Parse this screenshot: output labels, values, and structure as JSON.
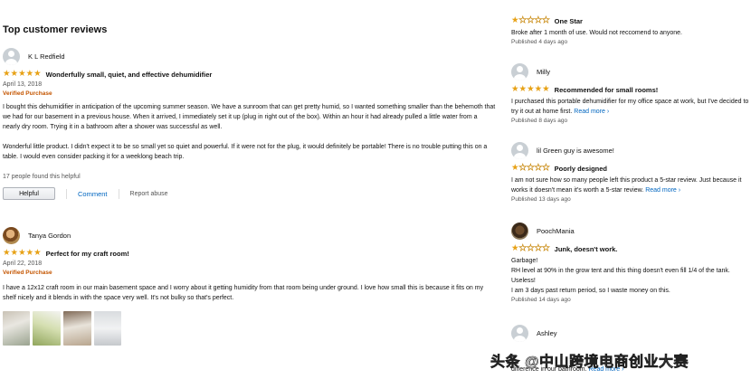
{
  "section_title": "Top customer reviews",
  "reviews": [
    {
      "name": "K L Redfield",
      "rating": 5,
      "title": "Wonderfully small, quiet, and effective dehumidifier",
      "date": "April 13, 2018",
      "verified": "Verified Purchase",
      "paragraphs": [
        "I bought this dehumidifier in anticipation of the upcoming summer season. We have a sunroom that can get pretty humid, so I wanted something smaller than the behemoth that we had for our basement in a previous house. When it arrived, I immediately set it up (plug in right out of the box). Within an hour it had already pulled a little water from a nearly dry room. Trying it in a bathroom after a shower was successful as well.",
        "Wonderful little product. I didn't expect it to be so small yet so quiet and powerful. If it were not for the plug, it would definitely be portable! There is no trouble putting this on a table. I would even consider packing it for a weeklong beach trip."
      ],
      "helpful_count": "17 people found this helpful",
      "helpful_button": "Helpful",
      "comment_link": "Comment",
      "abuse_link": "Report abuse"
    },
    {
      "name": "Tanya Gordon",
      "rating": 5,
      "title": "Perfect for my craft room!",
      "date": "April 22, 2018",
      "verified": "Verified Purchase",
      "paragraphs": [
        "I have a 12x12 craft room in our main basement space and I worry about it getting humidity from that room being under ground. I love how small this is because it fits on my shelf nicely and it blends in with the space very well. It's not bulky so that's perfect."
      ]
    }
  ],
  "side_reviews": [
    {
      "rating": 1,
      "title": "One Star",
      "text": "Broke after 1 month of use. Would not reccomend to anyone.",
      "published": "Published 4 days ago"
    },
    {
      "name": "Milly",
      "rating": 5,
      "title": "Recommended for small rooms!",
      "text": "I purchased this portable dehumidifier for my office space at work, but I've decided to try it out at home first.",
      "read_more": "Read more",
      "published": "Published 8 days ago"
    },
    {
      "name": "lil Green guy is awesome!",
      "rating": 1,
      "title": "Poorly designed",
      "text": "I am not sure how so many people left this product a 5-star review. Just because it works it doesn't mean it's worth a 5-star review.",
      "read_more": "Read more",
      "published": "Published 13 days ago"
    },
    {
      "name": "PoochMania",
      "rating": 1,
      "title": "Junk, doesn't work.",
      "lines": [
        "Garbage!",
        "RH level at 90% in the grow tent and this thing doesn't even fill 1/4 of the tank. Useless!",
        "I am 3 days past return period, so I waste money on this."
      ],
      "published": "Published 14 days ago"
    },
    {
      "name": "Ashley",
      "text_tail": "difference in our bathroom.",
      "read_more": "Read more"
    }
  ],
  "watermark": "头条 @中山跨境电商创业大赛",
  "colors": {
    "star": "#e7a115",
    "link": "#0066c0",
    "verified": "#c45500"
  }
}
